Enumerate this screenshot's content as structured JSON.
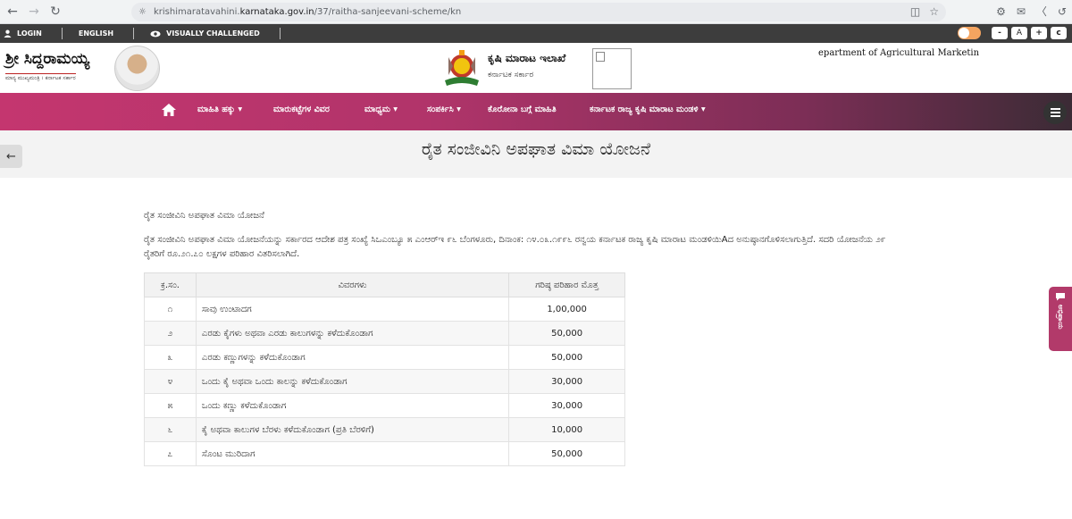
{
  "browser": {
    "url_prefix": "krishimaratavahini.",
    "url_host": "karnataka.gov.in",
    "url_path": "/37/raitha-sanjeevani-scheme/kn"
  },
  "util_bar": {
    "login": "LOGIN",
    "english": "ENGLISH",
    "visually_challenged": "VISUALLY CHALLENGED",
    "font_minus": "-",
    "font_normal": "A",
    "font_plus": "+",
    "reset": "c"
  },
  "header": {
    "cm_name": "ಶ್ರೀ ಸಿದ್ದರಾಮಯ್ಯ",
    "cm_title": "ಮಾನ್ಯ ಮುಖ್ಯಮಂತ್ರಿ । ಕರ್ನಾಟಕ ಸರ್ಕಾರ",
    "dept_kn": "ಕೃಷಿ ಮಾರಾಟ ಇಲಾಖೆ",
    "govt_kn": "ಕರ್ನಾಟಕ ಸರ್ಕಾರ",
    "dept_en": "epartment of Agricultural Marketin"
  },
  "nav": {
    "items": [
      "ಮಾಹಿತಿ ಹಕ್ಕು",
      "ಮಾರುಕಟ್ಟೆಗಳ ವಿವರ",
      "ಮಾಧ್ಯಮ",
      "ಸಂಪರ್ಕಿಸಿ",
      "ಕೊರೋನಾ ಬಗ್ಗೆ ಮಾಹಿತಿ",
      "ಕರ್ನಾಟಕ ರಾಜ್ಯ ಕೃಷಿ ಮಾರಾಟ ಮಂಡಳಿ"
    ]
  },
  "page": {
    "title": "ರೈತ ಸಂಜೀವಿನಿ ಅಪಘಾತ ವಿಮಾ ಯೋಜನೆ",
    "heading": "ರೈತ ಸಂಜೀವಿನಿ ಅಪಘಾತ ವಿಮಾ ಯೋಜನೆ",
    "paragraph": "ರೈತ ಸಂಜೀವಿನಿ ಅಪಘಾತ ವಿಮಾ ಯೋಜನೆಯನ್ನು ಸರ್ಕಾರದ ಆದೇಶ ಪತ್ರ ಸಂಖ್ಯೆ ಸಿಒಎಂಬ್ಯೂ ೫ ಎಂಆರ್‍ಇ ೯೬ ಬೆಂಗಳೂರು, ದಿನಾಂಕ: ೧೪.೦೩.೧೯೯೬ ರನ್ವಯ ಕರ್ನಾಟಕ ರಾಜ್ಯ ಕೃಷಿ ಮಾರಾಟ ಮಂಡಳಿಯಿAದ ಅನುಷ್ಠಾನಗೊಳಿಸಲಾಗುತ್ತಿದೆ. ಸದರಿ ಯೋಜನೆಯ ೨೯ ರೈತರಿಗೆ ರೂ.೨೧.೭೦ ಲಕ್ಷಗಳ ಪರಿಹಾರ ವಿತರಿಸಲಾಗಿದೆ."
  },
  "table": {
    "headers": [
      "ಕ್ರ.ಸಂ.",
      "ವಿವರಗಳು",
      "ಗರಿಷ್ಠ ಪರಿಹಾರ ಮೊತ್ತ"
    ],
    "rows": [
      [
        "೧",
        "ಸಾವು ಉಂಟಾದಗ",
        "1,00,000"
      ],
      [
        "೨",
        "ಎರಡು ಕೈಗಳು ಅಥವಾ ಎರಡು ಕಾಲುಗಳನ್ನು ಕಳೆದುಕೊಂಡಾಗ",
        "50,000"
      ],
      [
        "೩",
        "ಎರಡು ಕಣ್ಣುಗಳನ್ನು ಕಳೆದುಕೊಂಡಾಗ",
        "50,000"
      ],
      [
        "೪",
        "ಒಂದು ಕೈ ಅಥವಾ ಒಂದು ಕಾಲನ್ನು ಕಳೆದುಕೊಂಡಾಗ",
        "30,000"
      ],
      [
        "೫",
        "ಒಂದು ಕಣ್ಣು ಕಳೆದುಕೊಂಡಾಗ",
        "30,000"
      ],
      [
        "೬",
        "ಕೈ ಅಥವಾ ಕಾಲುಗಳ ಬೆರಳು ಕಳೆದುಕೊಂಡಾಗ (ಪ್ರತಿ ಬೆರಳಿಗೆ)",
        "10,000"
      ],
      [
        "೭",
        "ಸೊಂಟ ಮುರಿದಾಗ",
        "50,000"
      ]
    ]
  },
  "feedback_tab": "ಅಭಿಪ್ರಾಯ",
  "colors": {
    "nav_start": "#c4366f",
    "nav_end": "#3b2b35",
    "util_bar": "#3d3d3d",
    "accent": "#b23a6a"
  }
}
